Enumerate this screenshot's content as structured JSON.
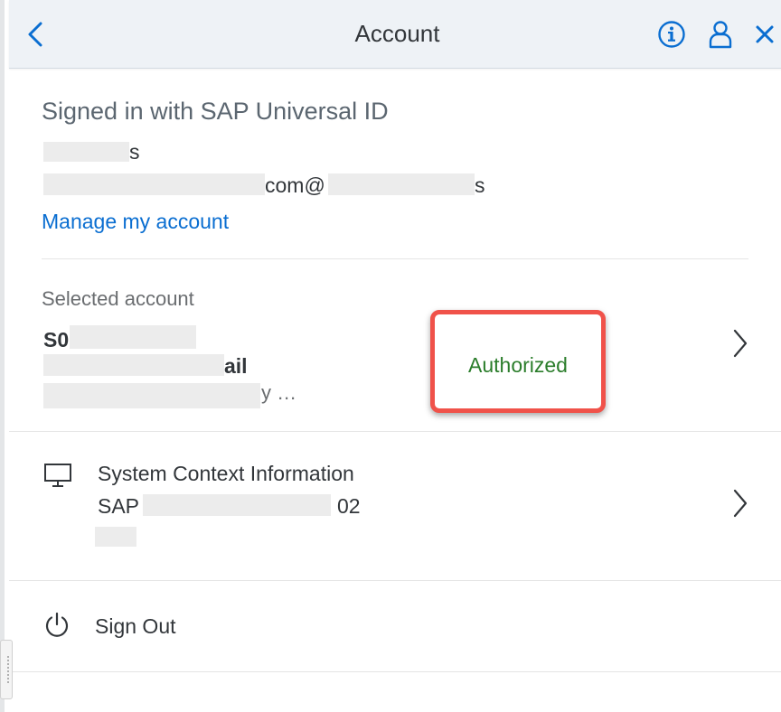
{
  "header": {
    "title": "Account",
    "back_icon": "chevron-left-icon",
    "info_icon": "info-icon",
    "user_icon": "user-icon",
    "close_icon": "close-icon"
  },
  "signed_in": {
    "heading": "Signed in with SAP Universal ID",
    "name_fragment": "s",
    "email_fragment_mid": "com@",
    "email_fragment_end": "s",
    "manage_link": "Manage my account"
  },
  "selected_account": {
    "label": "Selected account",
    "line1_fragment": "S0",
    "line2_fragment": "ail",
    "line3_fragment": "y …",
    "status": "Authorized",
    "status_color": "#2b7d2b"
  },
  "system_context": {
    "icon": "monitor-icon",
    "title": "System Context Information",
    "line1_prefix": "SAP",
    "line1_suffix": "02"
  },
  "sign_out": {
    "icon": "power-icon",
    "label": "Sign Out"
  },
  "colors": {
    "link": "#0a6ed1",
    "highlight_border": "#f0524a",
    "header_bg": "#eef2f6"
  }
}
